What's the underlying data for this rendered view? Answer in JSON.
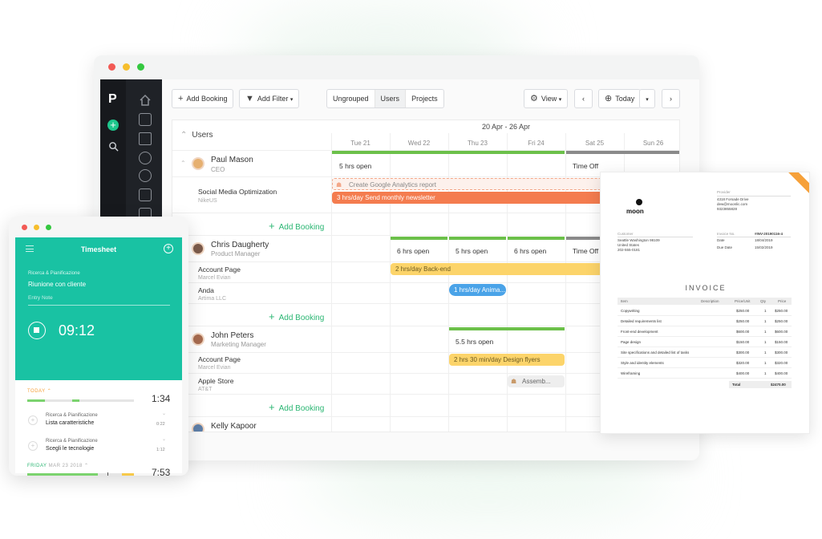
{
  "toolbar": {
    "add_booking": "Add Booking",
    "add_filter": "Add Filter",
    "segments": [
      "Ungrouped",
      "Users",
      "Projects"
    ],
    "view": "View",
    "today": "Today"
  },
  "schedule": {
    "date_range": "20 Apr - 26 Apr",
    "group_header": "Users",
    "days": [
      "Tue 21",
      "Wed 22",
      "Thu 23",
      "Fri 24",
      "Sat 25",
      "Sun 26"
    ],
    "add_booking_label": "Add Booking",
    "people": [
      {
        "name": "Paul Mason",
        "role": "CEO"
      },
      {
        "name": "Chris Daugherty",
        "role": "Product Manager"
      },
      {
        "name": "John Peters",
        "role": "Marketing Manager"
      },
      {
        "name": "Kelly Kapoor",
        "role": ""
      }
    ],
    "tasks": [
      {
        "name": "Social Media Optimization",
        "client": "NikeUS"
      },
      {
        "name": "Account Page",
        "client": "Marcel Evian"
      },
      {
        "name": "Anda",
        "client": "Artima LLC"
      },
      {
        "name": "Account Page",
        "client": "Marcel Evian"
      },
      {
        "name": "Apple Store",
        "client": "AT&T"
      }
    ],
    "capacity": {
      "paul": "5 hrs open",
      "time_off": "Time Off",
      "chris": [
        "6 hrs open",
        "5 hrs open",
        "6 hrs open"
      ],
      "john": "5.5 hrs open"
    },
    "bookings": {
      "ga_report": "Create Google Analytics report",
      "newsletter": "3 hrs/day Send monthly newsletter",
      "backend": "2 hrs/day Back-end",
      "anima": "1 hrs/day Anima...",
      "design_flyers": "2 hrs 30 min/day Design flyers",
      "assembly": "Assemb..."
    }
  },
  "invoice": {
    "brand": "moon",
    "provider_label": "Provider",
    "provider_lines": [
      "4318 Forsade Drive",
      "dew@moonlic.com",
      "9323855828"
    ],
    "customer_label": "Customer",
    "customer_lines": [
      "Seattle Washington 98109",
      "United States",
      "202-555-0181"
    ],
    "invoice_no_label": "Invoice No.",
    "invoice_no": "#INV-20190116-4",
    "date_label": "Date",
    "date": "18/04/2019",
    "due_label": "Due Date",
    "due": "15/02/2019",
    "title": "INVOICE",
    "columns": [
      "Item",
      "Description",
      "Price/Unit",
      "Qty",
      "Price"
    ],
    "items": [
      {
        "item": "Copywriting",
        "unit": "$250.00",
        "qty": "1",
        "price": "$250.00"
      },
      {
        "item": "Detailed requirements list",
        "unit": "$250.00",
        "qty": "1",
        "price": "$250.00"
      },
      {
        "item": "Front-end development",
        "unit": "$600.00",
        "qty": "1",
        "price": "$600.00"
      },
      {
        "item": "Page design",
        "unit": "$150.00",
        "qty": "1",
        "price": "$150.00"
      },
      {
        "item": "Site specifications and detailed list of tasks",
        "unit": "$300.00",
        "qty": "1",
        "price": "$300.00"
      },
      {
        "item": "Style and identity elements",
        "unit": "$320.00",
        "qty": "1",
        "price": "$320.00"
      },
      {
        "item": "Wireframing",
        "unit": "$400.00",
        "qty": "1",
        "price": "$400.00"
      }
    ],
    "total_label": "Total",
    "total": "$2470.00"
  },
  "timesheet": {
    "title": "Timesheet",
    "project": "Ricerca & Pianificazione",
    "task": "Riunione con cliente",
    "note_placeholder": "Entry Note",
    "timer": "09:12",
    "today_label": "TODAY",
    "today_total": "1:34",
    "entries": [
      {
        "project": "Ricerca & Pianificazione",
        "task": "Lista caratteristiche",
        "time": "0:22"
      },
      {
        "project": "Ricerca & Pianificazione",
        "task": "Scegli le tecnologie",
        "time": "1:12"
      }
    ],
    "friday_label": "FRIDAY",
    "friday_date": "MAR 23 2018",
    "friday_total": "7:53"
  },
  "colors": {
    "accent_green": "#2bb673",
    "timesheet_teal": "#19c2a3",
    "booking_orange": "#f47c4f",
    "booking_yellow": "#fcd46a",
    "booking_blue": "#4aa3e8"
  }
}
